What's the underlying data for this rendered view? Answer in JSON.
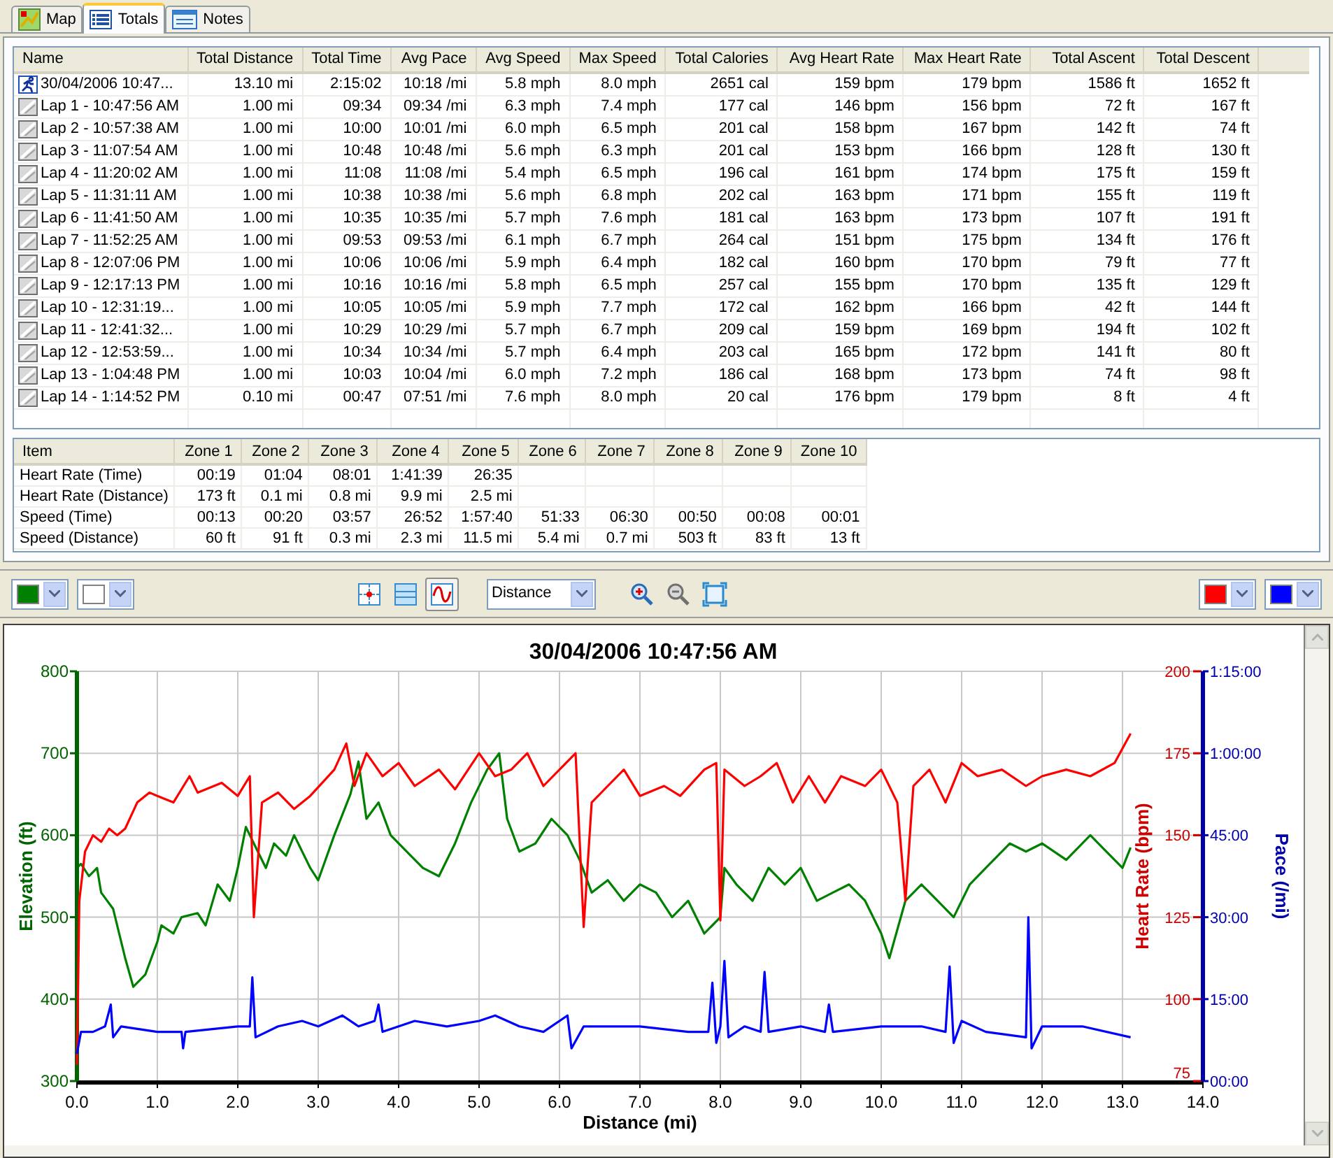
{
  "tabs": [
    {
      "label": "Map",
      "kind": "map",
      "selected": false
    },
    {
      "label": "Totals",
      "kind": "list",
      "selected": true
    },
    {
      "label": "Notes",
      "kind": "notes",
      "selected": false
    }
  ],
  "totals_table": {
    "columns": [
      "Name",
      "Total Distance",
      "Total Time",
      "Avg Pace",
      "Avg Speed",
      "Max Speed",
      "Total Calories",
      "Avg Heart Rate",
      "Max Heart Rate",
      "Total Ascent",
      "Total Descent"
    ],
    "rows": [
      {
        "kind": "activity",
        "cells": [
          "30/04/2006 10:47...",
          "13.10 mi",
          "2:15:02",
          "10:18 /mi",
          "5.8 mph",
          "8.0 mph",
          "2651 cal",
          "159 bpm",
          "179 bpm",
          "1586 ft",
          "1652 ft"
        ]
      },
      {
        "kind": "lap",
        "cells": [
          "Lap 1 - 10:47:56 AM",
          "1.00 mi",
          "09:34",
          "09:34 /mi",
          "6.3 mph",
          "7.4 mph",
          "177 cal",
          "146 bpm",
          "156 bpm",
          "72 ft",
          "167 ft"
        ]
      },
      {
        "kind": "lap",
        "cells": [
          "Lap 2 - 10:57:38 AM",
          "1.00 mi",
          "10:00",
          "10:01 /mi",
          "6.0 mph",
          "6.5 mph",
          "201 cal",
          "158 bpm",
          "167 bpm",
          "142 ft",
          "74 ft"
        ]
      },
      {
        "kind": "lap",
        "cells": [
          "Lap 3 - 11:07:54 AM",
          "1.00 mi",
          "10:48",
          "10:48 /mi",
          "5.6 mph",
          "6.3 mph",
          "201 cal",
          "153 bpm",
          "166 bpm",
          "128 ft",
          "130 ft"
        ]
      },
      {
        "kind": "lap",
        "cells": [
          "Lap 4 - 11:20:02 AM",
          "1.00 mi",
          "11:08",
          "11:08 /mi",
          "5.4 mph",
          "6.5 mph",
          "196 cal",
          "161 bpm",
          "174 bpm",
          "175 ft",
          "159 ft"
        ]
      },
      {
        "kind": "lap",
        "cells": [
          "Lap 5 - 11:31:11 AM",
          "1.00 mi",
          "10:38",
          "10:38 /mi",
          "5.6 mph",
          "6.8 mph",
          "202 cal",
          "163 bpm",
          "171 bpm",
          "155 ft",
          "119 ft"
        ]
      },
      {
        "kind": "lap",
        "cells": [
          "Lap 6 - 11:41:50 AM",
          "1.00 mi",
          "10:35",
          "10:35 /mi",
          "5.7 mph",
          "7.6 mph",
          "181 cal",
          "163 bpm",
          "173 bpm",
          "107 ft",
          "191 ft"
        ]
      },
      {
        "kind": "lap",
        "cells": [
          "Lap 7 - 11:52:25 AM",
          "1.00 mi",
          "09:53",
          "09:53 /mi",
          "6.1 mph",
          "6.7 mph",
          "264 cal",
          "151 bpm",
          "175 bpm",
          "134 ft",
          "176 ft"
        ]
      },
      {
        "kind": "lap",
        "cells": [
          "Lap 8 - 12:07:06 PM",
          "1.00 mi",
          "10:06",
          "10:06 /mi",
          "5.9 mph",
          "6.4 mph",
          "182 cal",
          "160 bpm",
          "170 bpm",
          "79 ft",
          "77 ft"
        ]
      },
      {
        "kind": "lap",
        "cells": [
          "Lap 9 - 12:17:13 PM",
          "1.00 mi",
          "10:16",
          "10:16 /mi",
          "5.8 mph",
          "6.5 mph",
          "257 cal",
          "155 bpm",
          "170 bpm",
          "135 ft",
          "129 ft"
        ]
      },
      {
        "kind": "lap",
        "cells": [
          "Lap 10 - 12:31:19...",
          "1.00 mi",
          "10:05",
          "10:05 /mi",
          "5.9 mph",
          "7.7 mph",
          "172 cal",
          "162 bpm",
          "166 bpm",
          "42 ft",
          "144 ft"
        ]
      },
      {
        "kind": "lap",
        "cells": [
          "Lap 11 - 12:41:32...",
          "1.00 mi",
          "10:29",
          "10:29 /mi",
          "5.7 mph",
          "6.7 mph",
          "209 cal",
          "159 bpm",
          "169 bpm",
          "194 ft",
          "102 ft"
        ]
      },
      {
        "kind": "lap",
        "cells": [
          "Lap 12 - 12:53:59...",
          "1.00 mi",
          "10:34",
          "10:34 /mi",
          "5.7 mph",
          "6.4 mph",
          "203 cal",
          "165 bpm",
          "172 bpm",
          "141 ft",
          "80 ft"
        ]
      },
      {
        "kind": "lap",
        "cells": [
          "Lap 13 - 1:04:48 PM",
          "1.00 mi",
          "10:03",
          "10:04 /mi",
          "6.0 mph",
          "7.2 mph",
          "186 cal",
          "168 bpm",
          "173 bpm",
          "74 ft",
          "98 ft"
        ]
      },
      {
        "kind": "lap",
        "cells": [
          "Lap 14 - 1:14:52 PM",
          "0.10 mi",
          "00:47",
          "07:51 /mi",
          "7.6 mph",
          "8.0 mph",
          "20 cal",
          "176 bpm",
          "179 bpm",
          "8 ft",
          "4 ft"
        ]
      }
    ]
  },
  "zones_table": {
    "columns": [
      "Item",
      "Zone 1",
      "Zone 2",
      "Zone 3",
      "Zone 4",
      "Zone 5",
      "Zone 6",
      "Zone 7",
      "Zone 8",
      "Zone 9",
      "Zone 10"
    ],
    "rows": [
      [
        "Heart Rate (Time)",
        "00:19",
        "01:04",
        "08:01",
        "1:41:39",
        "26:35"
      ],
      [
        "Heart Rate (Distance)",
        "173 ft",
        "0.1 mi",
        "0.8 mi",
        "9.9 mi",
        "2.5 mi"
      ],
      [
        "Speed (Time)",
        "00:13",
        "00:20",
        "03:57",
        "26:52",
        "1:57:40",
        "51:33",
        "06:30",
        "00:50",
        "00:08",
        "00:01"
      ],
      [
        "Speed (Distance)",
        "60 ft",
        "91 ft",
        "0.3 mi",
        "2.3 mi",
        "11.5 mi",
        "5.4 mi",
        "0.7 mi",
        "503 ft",
        "83 ft",
        "13 ft"
      ]
    ]
  },
  "toolbar": {
    "left_pickers": [
      {
        "color": "#008000"
      },
      {
        "color": "#ffffff"
      }
    ],
    "view_buttons": [
      {
        "kind": "crosshair",
        "selected": false
      },
      {
        "kind": "bands",
        "selected": false
      },
      {
        "kind": "curve",
        "selected": true
      }
    ],
    "x_axis_select": "Distance",
    "zoom_buttons": [
      {
        "kind": "zoom-in"
      },
      {
        "kind": "zoom-out"
      },
      {
        "kind": "fit"
      }
    ],
    "right_pickers": [
      {
        "color": "#ff0000"
      },
      {
        "color": "#0000ff"
      }
    ]
  },
  "chart": {
    "chart_data": {
      "type": "line",
      "title": "30/04/2006 10:47:56 AM",
      "xlabel": "Distance (mi)",
      "ylabel": "Elevation (ft)",
      "x": [
        0,
        0.05,
        0.15,
        0.25,
        0.3,
        0.45,
        0.6,
        0.7,
        0.85,
        1.0,
        1.05,
        1.2,
        1.3,
        1.5,
        1.6,
        1.75,
        1.9,
        2.0,
        2.1,
        2.2,
        2.35,
        2.45,
        2.6,
        2.7,
        2.9,
        3.0,
        3.2,
        3.4,
        3.5,
        3.6,
        3.75,
        3.9,
        4.1,
        4.3,
        4.5,
        4.7,
        4.9,
        5.1,
        5.25,
        5.35,
        5.5,
        5.7,
        5.9,
        6.1,
        6.25,
        6.4,
        6.6,
        6.8,
        7.0,
        7.2,
        7.4,
        7.6,
        7.8,
        8.0,
        8.05,
        8.2,
        8.4,
        8.6,
        8.8,
        9.0,
        9.2,
        9.4,
        9.6,
        9.8,
        10.0,
        10.1,
        10.3,
        10.5,
        10.7,
        10.9,
        11.1,
        11.3,
        11.6,
        11.8,
        12.0,
        12.3,
        12.6,
        12.8,
        13.0,
        13.1
      ],
      "series": [
        {
          "color": "#008000",
          "values": [
            560,
            565,
            550,
            560,
            530,
            510,
            450,
            415,
            430,
            470,
            490,
            480,
            500,
            505,
            490,
            540,
            520,
            560,
            610,
            590,
            560,
            590,
            575,
            600,
            560,
            545,
            600,
            650,
            690,
            620,
            640,
            600,
            580,
            560,
            550,
            590,
            640,
            680,
            700,
            620,
            580,
            590,
            620,
            600,
            570,
            530,
            545,
            520,
            540,
            530,
            500,
            520,
            480,
            500,
            560,
            540,
            520,
            560,
            540,
            560,
            520,
            530,
            540,
            520,
            480,
            450,
            520,
            540,
            520,
            500,
            540,
            560,
            590,
            580,
            590,
            570,
            600,
            580,
            560,
            585
          ]
        }
      ],
      "xlim": [
        0,
        14
      ],
      "ylim": [
        300,
        800
      ],
      "xticks": [
        {
          "value": 0,
          "label": "0.0"
        },
        {
          "value": 1,
          "label": "1.0"
        },
        {
          "value": 2,
          "label": "2.0"
        },
        {
          "value": 3,
          "label": "3.0"
        },
        {
          "value": 4,
          "label": "4.0"
        },
        {
          "value": 5,
          "label": "5.0"
        },
        {
          "value": 6,
          "label": "6.0"
        },
        {
          "value": 7,
          "label": "7.0"
        },
        {
          "value": 8,
          "label": "8.0"
        },
        {
          "value": 9,
          "label": "9.0"
        },
        {
          "value": 10,
          "label": "10.0"
        },
        {
          "value": 11,
          "label": "11.0"
        },
        {
          "value": 12,
          "label": "12.0"
        },
        {
          "value": 13,
          "label": "13.0"
        },
        {
          "value": 14,
          "label": "14.0"
        }
      ],
      "yticks": [
        800,
        700,
        600,
        500,
        400,
        300
      ],
      "grid": true
    },
    "right_axes": [
      {
        "chart_data": {
          "type": "line",
          "ylabel": "Heart Rate (bpm)",
          "x": [
            0,
            0.03,
            0.1,
            0.2,
            0.3,
            0.4,
            0.5,
            0.6,
            0.75,
            0.9,
            1.0,
            1.2,
            1.4,
            1.5,
            1.8,
            2.0,
            2.15,
            2.2,
            2.3,
            2.5,
            2.7,
            2.9,
            3.2,
            3.35,
            3.45,
            3.6,
            3.8,
            4.0,
            4.2,
            4.5,
            4.7,
            5.0,
            5.2,
            5.4,
            5.6,
            5.8,
            6.0,
            6.2,
            6.3,
            6.4,
            6.6,
            6.8,
            7.0,
            7.3,
            7.5,
            7.8,
            7.95,
            8.0,
            8.05,
            8.3,
            8.5,
            8.7,
            8.9,
            9.1,
            9.3,
            9.5,
            9.8,
            10.0,
            10.2,
            10.3,
            10.4,
            10.6,
            10.8,
            11.0,
            11.2,
            11.5,
            11.8,
            12.0,
            12.3,
            12.6,
            12.9,
            13.1
          ],
          "series": [
            {
              "color": "#ff0000",
              "values": [
                80,
                130,
                145,
                150,
                148,
                152,
                150,
                152,
                160,
                163,
                162,
                160,
                168,
                163,
                166,
                162,
                168,
                125,
                160,
                163,
                158,
                162,
                170,
                178,
                165,
                175,
                168,
                172,
                165,
                170,
                164,
                175,
                168,
                170,
                175,
                165,
                170,
                175,
                122,
                160,
                165,
                170,
                162,
                165,
                162,
                170,
                172,
                124,
                170,
                165,
                168,
                172,
                160,
                168,
                160,
                168,
                165,
                170,
                160,
                130,
                165,
                170,
                160,
                172,
                168,
                170,
                165,
                168,
                170,
                168,
                172,
                181
              ]
            }
          ],
          "xlim": [
            0,
            14
          ],
          "ylim": [
            75,
            200
          ],
          "yticks": [
            {
              "value": 200,
              "label": "200"
            },
            {
              "value": 175,
              "label": "175"
            },
            {
              "value": 150,
              "label": "150"
            },
            {
              "value": 125,
              "label": "125"
            },
            {
              "value": 100,
              "label": "100"
            },
            {
              "value": 75,
              "label": "75"
            }
          ]
        }
      },
      {
        "chart_data": {
          "type": "line",
          "ylabel": "Pace (/mi)",
          "x": [
            0,
            0.05,
            0.2,
            0.35,
            0.42,
            0.45,
            0.55,
            1.0,
            1.3,
            1.32,
            1.35,
            2.0,
            2.15,
            2.18,
            2.22,
            2.5,
            2.8,
            3.0,
            3.3,
            3.5,
            3.7,
            3.75,
            3.8,
            4.2,
            4.6,
            5.0,
            5.2,
            5.5,
            5.8,
            6.1,
            6.15,
            6.3,
            7.0,
            7.6,
            7.85,
            7.9,
            7.95,
            8.0,
            8.05,
            8.1,
            8.3,
            8.5,
            8.55,
            8.6,
            9.0,
            9.3,
            9.35,
            9.4,
            10.0,
            10.5,
            10.8,
            10.85,
            10.9,
            11.0,
            11.3,
            11.8,
            11.83,
            11.87,
            12.0,
            12.5,
            13.1
          ],
          "series": [
            {
              "color": "#0000ff",
              "values": [
                5,
                9,
                9,
                10,
                14,
                8,
                10,
                9,
                9,
                6,
                9,
                10,
                10,
                19,
                8,
                10,
                11,
                10,
                12,
                10,
                11,
                14,
                9,
                11,
                10,
                11,
                12,
                10,
                9,
                12,
                6,
                10,
                10,
                9,
                9,
                18,
                7,
                10,
                22,
                8,
                10,
                9,
                20,
                9,
                10,
                9,
                14,
                9,
                10,
                10,
                9,
                21,
                7,
                11,
                9,
                8,
                30,
                6,
                10,
                10,
                8
              ]
            }
          ],
          "xlim": [
            0,
            14
          ],
          "ylim": [
            0,
            75
          ],
          "yticks": [
            {
              "value": 75,
              "label": "1:15:00"
            },
            {
              "value": 60,
              "label": "1:00:00"
            },
            {
              "value": 45,
              "label": "45:00"
            },
            {
              "value": 30,
              "label": "30:00"
            },
            {
              "value": 15,
              "label": "15:00"
            },
            {
              "value": 0,
              "label": "00:00"
            }
          ]
        }
      }
    ]
  }
}
